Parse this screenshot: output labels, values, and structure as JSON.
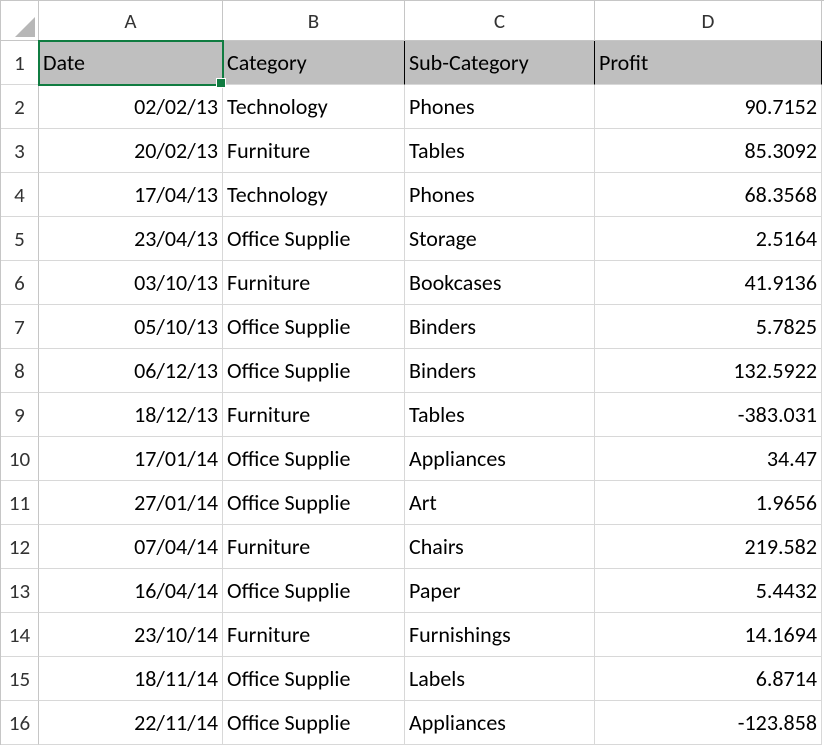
{
  "columns": [
    "A",
    "B",
    "C",
    "D"
  ],
  "row_numbers": [
    1,
    2,
    3,
    4,
    5,
    6,
    7,
    8,
    9,
    10,
    11,
    12,
    13,
    14,
    15,
    16
  ],
  "headers": [
    "Date",
    "Category",
    "Sub-Category",
    "Profit"
  ],
  "rows": [
    {
      "date": "02/02/13",
      "category": "Technology",
      "subcategory": "Phones",
      "profit": "90.7152"
    },
    {
      "date": "20/02/13",
      "category": "Furniture",
      "subcategory": "Tables",
      "profit": "85.3092"
    },
    {
      "date": "17/04/13",
      "category": "Technology",
      "subcategory": "Phones",
      "profit": "68.3568"
    },
    {
      "date": "23/04/13",
      "category": "Office Supplie",
      "subcategory": "Storage",
      "profit": "2.5164"
    },
    {
      "date": "03/10/13",
      "category": "Furniture",
      "subcategory": "Bookcases",
      "profit": "41.9136"
    },
    {
      "date": "05/10/13",
      "category": "Office Supplie",
      "subcategory": "Binders",
      "profit": "5.7825"
    },
    {
      "date": "06/12/13",
      "category": "Office Supplie",
      "subcategory": "Binders",
      "profit": "132.5922"
    },
    {
      "date": "18/12/13",
      "category": "Furniture",
      "subcategory": "Tables",
      "profit": "-383.031"
    },
    {
      "date": "17/01/14",
      "category": "Office Supplie",
      "subcategory": "Appliances",
      "profit": "34.47"
    },
    {
      "date": "27/01/14",
      "category": "Office Supplie",
      "subcategory": "Art",
      "profit": "1.9656"
    },
    {
      "date": "07/04/14",
      "category": "Furniture",
      "subcategory": "Chairs",
      "profit": "219.582"
    },
    {
      "date": "16/04/14",
      "category": "Office Supplie",
      "subcategory": "Paper",
      "profit": "5.4432"
    },
    {
      "date": "23/10/14",
      "category": "Furniture",
      "subcategory": "Furnishings",
      "profit": "14.1694"
    },
    {
      "date": "18/11/14",
      "category": "Office Supplie",
      "subcategory": "Labels",
      "profit": "6.8714"
    },
    {
      "date": "22/11/14",
      "category": "Office Supplie",
      "subcategory": "Appliances",
      "profit": "-123.858"
    }
  ]
}
